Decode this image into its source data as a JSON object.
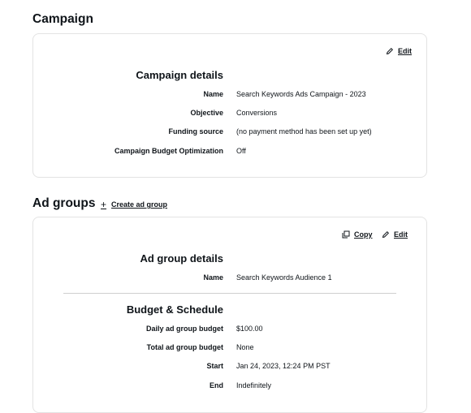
{
  "campaign": {
    "title": "Campaign",
    "edit_label": "Edit",
    "details_heading": "Campaign details",
    "rows": [
      {
        "label": "Name",
        "value": "Search Keywords Ads Campaign - 2023"
      },
      {
        "label": "Objective",
        "value": "Conversions"
      },
      {
        "label": "Funding source",
        "value": "(no payment method has been set up yet)"
      },
      {
        "label": "Campaign Budget Optimization",
        "value": "Off"
      }
    ]
  },
  "ad_groups": {
    "title": "Ad groups",
    "create_label": "Create ad group",
    "copy_label": "Copy",
    "edit_label": "Edit",
    "details_heading": "Ad group details",
    "details_rows": [
      {
        "label": "Name",
        "value": "Search Keywords Audience 1"
      }
    ],
    "budget_heading": "Budget & Schedule",
    "budget_rows": [
      {
        "label": "Daily ad group budget",
        "value": "$100.00"
      },
      {
        "label": "Total ad group budget",
        "value": "None"
      },
      {
        "label": "Start",
        "value": "Jan 24, 2023, 12:24 PM PST"
      },
      {
        "label": "End",
        "value": "Indefinitely"
      }
    ]
  }
}
